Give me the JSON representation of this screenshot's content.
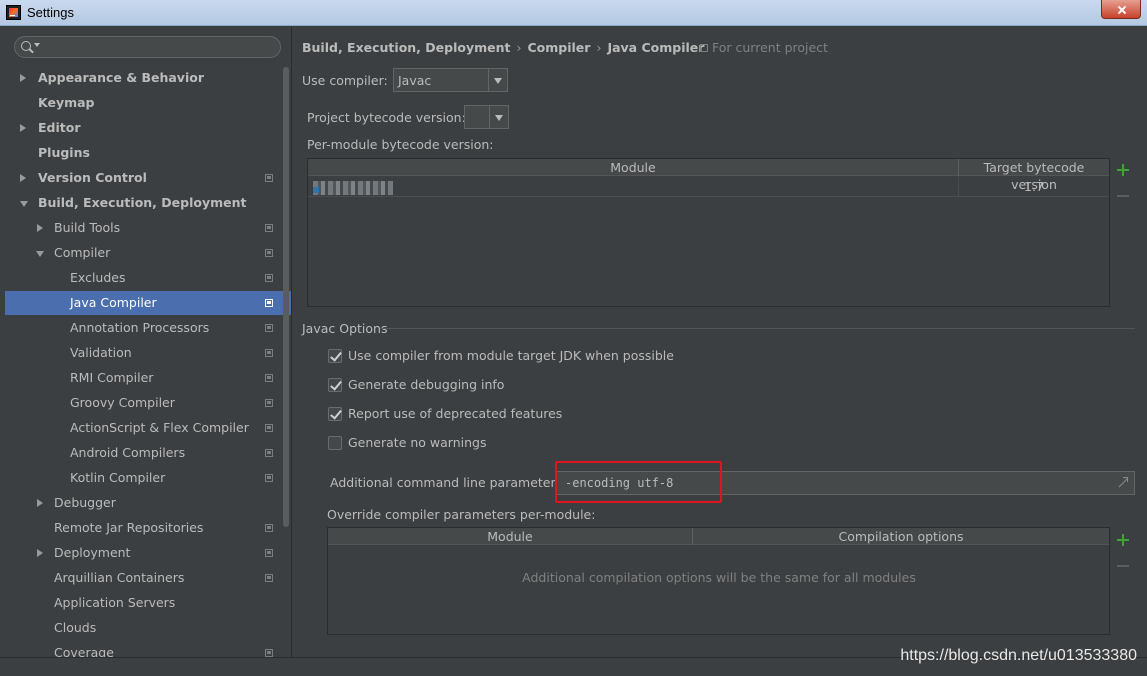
{
  "window": {
    "title": "Settings"
  },
  "sidebar": {
    "search_placeholder": "",
    "items": [
      {
        "label": "Appearance & Behavior"
      },
      {
        "label": "Keymap"
      },
      {
        "label": "Editor"
      },
      {
        "label": "Plugins"
      },
      {
        "label": "Version Control"
      },
      {
        "label": "Build, Execution, Deployment"
      },
      {
        "label": "Build Tools"
      },
      {
        "label": "Compiler"
      },
      {
        "label": "Excludes"
      },
      {
        "label": "Java Compiler"
      },
      {
        "label": "Annotation Processors"
      },
      {
        "label": "Validation"
      },
      {
        "label": "RMI Compiler"
      },
      {
        "label": "Groovy Compiler"
      },
      {
        "label": "ActionScript & Flex Compiler"
      },
      {
        "label": "Android Compilers"
      },
      {
        "label": "Kotlin Compiler"
      },
      {
        "label": "Debugger"
      },
      {
        "label": "Remote Jar Repositories"
      },
      {
        "label": "Deployment"
      },
      {
        "label": "Arquillian Containers"
      },
      {
        "label": "Application Servers"
      },
      {
        "label": "Clouds"
      },
      {
        "label": "Coverage"
      }
    ]
  },
  "breadcrumb": {
    "part1": "Build, Execution, Deployment",
    "part2": "Compiler",
    "part3": "Java Compiler",
    "sep": "›",
    "scope": "For current project"
  },
  "compiler": {
    "use_compiler_label": "Use compiler:",
    "use_compiler_value": "Javac",
    "project_bytecode_label": "Project bytecode version:",
    "project_bytecode_value": "",
    "per_module_label": "Per-module bytecode version:",
    "table": {
      "col_module": "Module",
      "col_target": "Target bytecode version",
      "rows": [
        {
          "module": "",
          "target": "1.7"
        }
      ]
    }
  },
  "javac_options": {
    "title": "Javac Options",
    "checkboxes": [
      {
        "label": "Use compiler from module target JDK when possible",
        "checked": true
      },
      {
        "label": "Generate debugging info",
        "checked": true
      },
      {
        "label": "Report use of deprecated features",
        "checked": true
      },
      {
        "label": "Generate no warnings",
        "checked": false
      }
    ],
    "additional_params_label": "Additional command line parameters:",
    "additional_params_value": "-encoding utf-8",
    "override_label": "Override compiler parameters per-module:",
    "override_table": {
      "col_module": "Module",
      "col_options": "Compilation options",
      "empty_text": "Additional compilation options will be the same for all modules"
    }
  },
  "watermark": "https://blog.csdn.net/u013533380",
  "colors": {
    "selection": "#4b6eaf",
    "background": "#3c3f41",
    "add_green": "#3fa532",
    "highlight_red": "#e0141e"
  }
}
